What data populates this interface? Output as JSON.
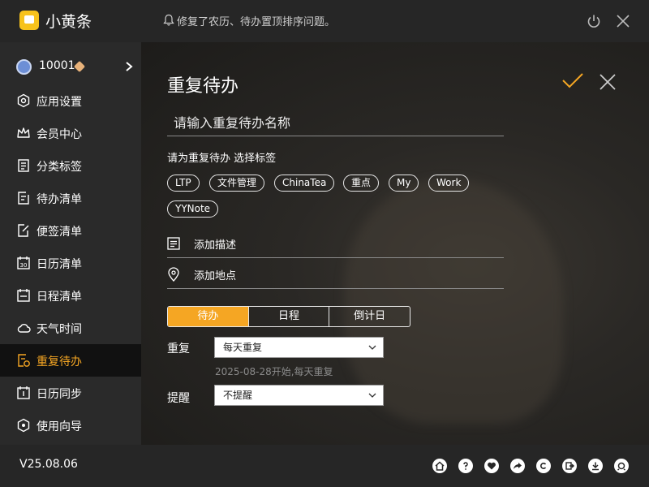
{
  "app": {
    "title": "小黄条",
    "notice": "修复了农历、待办置顶排序问题。"
  },
  "user": {
    "id": "10001"
  },
  "sidebar": {
    "items": [
      {
        "label": "应用设置",
        "icon": "gear-icon"
      },
      {
        "label": "会员中心",
        "icon": "crown-icon"
      },
      {
        "label": "分类标签",
        "icon": "tag-icon"
      },
      {
        "label": "待办清单",
        "icon": "todo-icon"
      },
      {
        "label": "便签清单",
        "icon": "note-icon"
      },
      {
        "label": "日历清单",
        "icon": "calendar-30-icon"
      },
      {
        "label": "日程清单",
        "icon": "schedule-icon"
      },
      {
        "label": "天气时间",
        "icon": "cloud-icon"
      },
      {
        "label": "重复待办",
        "icon": "repeat-todo-icon",
        "active": true
      },
      {
        "label": "日历同步",
        "icon": "calendar-sync-icon"
      },
      {
        "label": "使用向导",
        "icon": "guide-icon"
      }
    ]
  },
  "main": {
    "title": "重复待办",
    "name_placeholder": "请输入重复待办名称",
    "tag_hint": "请为重复待办 选择标签",
    "tags": [
      "LTP",
      "文件管理",
      "ChinaTea",
      "重点",
      "My",
      "Work",
      "YYNote"
    ],
    "add_description": "添加描述",
    "add_location": "添加地点",
    "segments": [
      "待办",
      "日程",
      "倒计日"
    ],
    "active_segment": "待办",
    "repeat_label": "重复",
    "repeat_value": "每天重复",
    "repeat_hint": "2025-08-28开始,每天重复",
    "remind_label": "提醒",
    "remind_value": "不提醒"
  },
  "footer": {
    "version": "V25.08.06",
    "icons": [
      "home-icon",
      "help-icon",
      "heart-icon",
      "share-icon",
      "copyright-icon",
      "export-icon",
      "download-icon",
      "support-icon"
    ]
  },
  "colors": {
    "accent": "#f5a623",
    "logo": "#f7c21b",
    "titlebar": "#262626",
    "sidebar": "#2a2a2a",
    "active_bg": "#111111"
  }
}
